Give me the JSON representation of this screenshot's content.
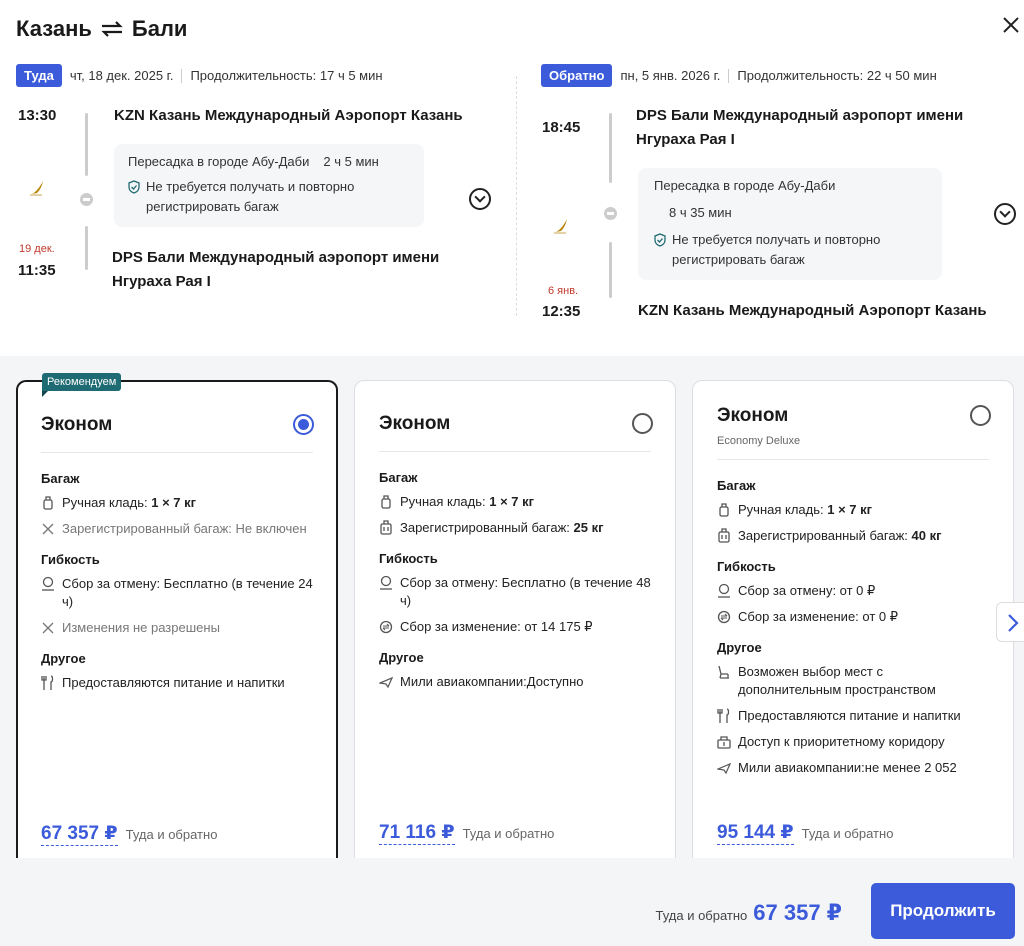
{
  "header": {
    "origin": "Казань",
    "destination": "Бали",
    "swap_icon": "swap-arrows-icon",
    "close_icon": "close-icon"
  },
  "outbound": {
    "badge": "Туда",
    "date": "чт, 18 дек. 2025 г.",
    "duration": "Продолжительность: 17 ч 5 мин",
    "dep_time": "13:30",
    "dep_airport": "KZN Казань Международный Аэропорт Казань",
    "transfer_city": "Пересадка в городе Абу-Даби",
    "transfer_time": "2 ч 5 мин",
    "baggage_note": "Не требуется получать и повторно регистрировать багаж",
    "arr_date": "19 дек.",
    "arr_time": "11:35",
    "arr_airport": "DPS Бали Международный аэропорт имени Нгураха Рая I"
  },
  "inbound": {
    "badge": "Обратно",
    "date": "пн, 5 янв. 2026 г.",
    "duration": "Продолжительность: 22 ч 50 мин",
    "dep_time": "18:45",
    "dep_airport": "DPS Бали Международный аэропорт имени Нгураха Рая I",
    "transfer_city": "Пересадка в городе Абу-Даби",
    "transfer_time": "8 ч 35 мин",
    "baggage_note": "Не требуется получать и повторно регистрировать багаж",
    "arr_date": "6 янв.",
    "arr_time": "12:35",
    "arr_airport": "KZN Казань Международный Аэропорт Казань"
  },
  "fares": [
    {
      "badge": "Рекомендуем",
      "name": "Эконом",
      "subtitle": "",
      "selected": true,
      "baggage_title": "Багаж",
      "hand_label": "Ручная кладь: ",
      "hand_value": "1 × 7 кг",
      "checked_label": "Зарегистрированный багаж: Не включен",
      "checked_value": "",
      "flex_title": "Гибкость",
      "cancel": "Сбор за отмену: Бесплатно (в течение 24 ч)",
      "change": "Изменения не разрешены",
      "other_title": "Другое",
      "other": [
        "Предоставляются питание и напитки"
      ],
      "price": "67 357 ₽",
      "price_label": "Туда и обратно"
    },
    {
      "name": "Эконом",
      "subtitle": "",
      "selected": false,
      "baggage_title": "Багаж",
      "hand_label": "Ручная кладь: ",
      "hand_value": "1 × 7 кг",
      "checked_label": "Зарегистрированный багаж: ",
      "checked_value": "25 кг",
      "flex_title": "Гибкость",
      "cancel": "Сбор за отмену: Бесплатно (в течение 48 ч)",
      "change": "Сбор за изменение: от 14 175 ₽",
      "other_title": "Другое",
      "other": [
        "Мили авиакомпании:Доступно"
      ],
      "price": "71 116 ₽",
      "price_label": "Туда и обратно"
    },
    {
      "name": "Эконом",
      "subtitle": "Economy Deluxe",
      "selected": false,
      "baggage_title": "Багаж",
      "hand_label": "Ручная кладь: ",
      "hand_value": "1 × 7 кг",
      "checked_label": "Зарегистрированный багаж: ",
      "checked_value": "40 кг",
      "flex_title": "Гибкость",
      "cancel": "Сбор за отмену: от 0 ₽",
      "change": "Сбор за изменение: от 0 ₽",
      "other_title": "Другое",
      "other": [
        "Возможен выбор мест с дополнительным пространством",
        "Предоставляются питание и напитки",
        "Доступ к приоритетному коридору",
        "Мили авиакомпании:не менее 2 052"
      ],
      "price": "95 144 ₽",
      "price_label": "Туда и обратно"
    }
  ],
  "footer": {
    "total_label": "Туда и обратно",
    "total_price": "67 357 ₽",
    "continue": "Продолжить"
  },
  "colors": {
    "accent": "#3b5bdb",
    "badge_recommend": "#1f6b73",
    "arrival_date": "#c0392b"
  }
}
